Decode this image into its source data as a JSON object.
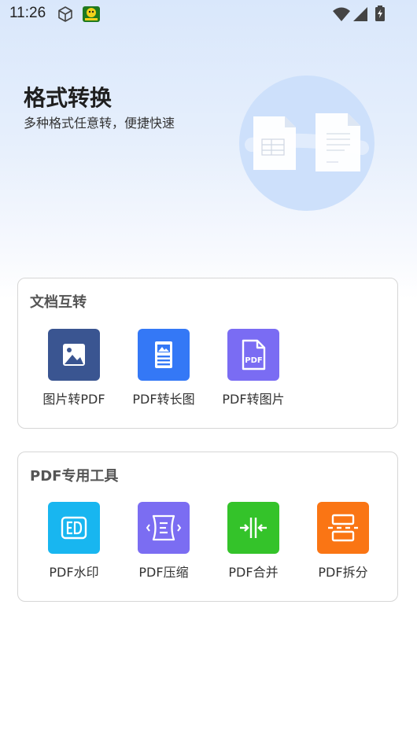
{
  "status_bar": {
    "time": "11:26"
  },
  "hero": {
    "title": "格式转换",
    "subtitle": "多种格式任意转，便捷快速"
  },
  "sections": [
    {
      "title": "文档互转",
      "tools": [
        {
          "label": "图片转PDF",
          "icon": "image-icon",
          "color": "#3a5591"
        },
        {
          "label": "PDF转长图",
          "icon": "long-image-icon",
          "color": "#3478f6"
        },
        {
          "label": "PDF转图片",
          "icon": "pdf-file-icon",
          "color": "#7a6cf3"
        }
      ]
    },
    {
      "title": "PDF专用工具",
      "tools": [
        {
          "label": "PDF水印",
          "icon": "watermark-icon",
          "color": "#18b6f0"
        },
        {
          "label": "PDF压缩",
          "icon": "compress-icon",
          "color": "#7b6df2"
        },
        {
          "label": "PDF合并",
          "icon": "merge-icon",
          "color": "#34c32a"
        },
        {
          "label": "PDF拆分",
          "icon": "split-icon",
          "color": "#fa7514"
        }
      ]
    }
  ]
}
